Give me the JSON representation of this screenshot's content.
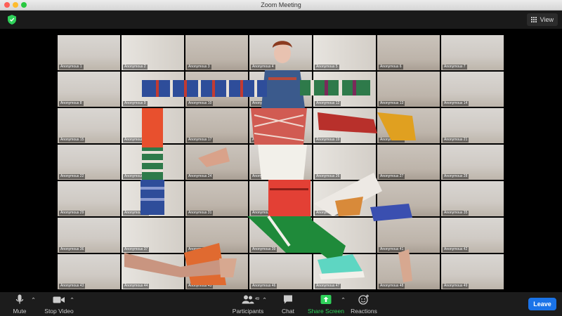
{
  "window": {
    "title": "Zoom Meeting"
  },
  "topbar": {
    "view_label": "View"
  },
  "tiles": [
    "Anonymous 1",
    "Anonymous 2",
    "Anonymous 3",
    "Anonymous 4",
    "Anonymous 5",
    "Anonymous 6",
    "Anonymous 7",
    "Anonymous 8",
    "Anonymous 9",
    "Anonymous 10",
    "Anonymous 11",
    "Anonymous 12",
    "Anonymous 13",
    "Anonymous 14",
    "Anonymous 15",
    "Anonymous 16",
    "Anonymous 17",
    "Anonymous 18",
    "Anonymous 19",
    "Anonymous 20",
    "Anonymous 21",
    "Anonymous 22",
    "Anonymous 23",
    "Anonymous 24",
    "Anonymous 25",
    "Anonymous 26",
    "Anonymous 27",
    "Anonymous 28",
    "Anonymous 29",
    "Anonymous 30",
    "Anonymous 31",
    "Anonymous 32",
    "Anonymous 33",
    "Anonymous 34",
    "Anonymous 35",
    "Anonymous 36",
    "Anonymous 37",
    "Anonymous 38",
    "Anonymous 39",
    "Anonymous 40",
    "Anonymous 41",
    "Anonymous 42",
    "Anonymous 43",
    "Anonymous 44",
    "Anonymous 45",
    "Anonymous 46",
    "Anonymous 47",
    "Anonymous 48",
    "Anonymous 49"
  ],
  "toolbar": {
    "mute_label": "Mute",
    "stop_video_label": "Stop Video",
    "participants_label": "Participants",
    "participants_count": "49",
    "chat_label": "Chat",
    "share_screen_label": "Share Screen",
    "reactions_label": "Reactions",
    "leave_label": "Leave"
  },
  "colors": {
    "share_accent": "#2fd15a",
    "leave_button": "#1a73e8",
    "shield": "#2fd15a"
  },
  "icons": [
    "shield-icon",
    "grid-view-icon",
    "microphone-icon",
    "video-camera-icon",
    "participants-icon",
    "chat-bubble-icon",
    "share-screen-icon",
    "reactions-icon"
  ]
}
